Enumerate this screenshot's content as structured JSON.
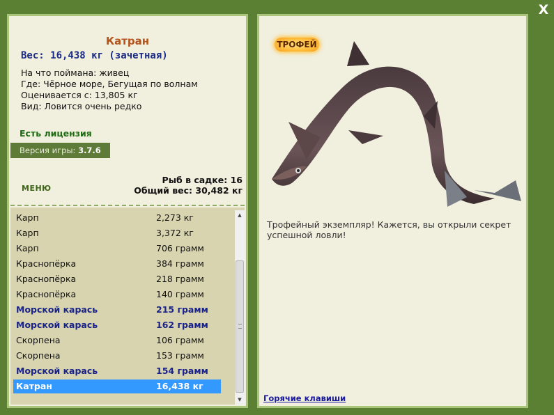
{
  "close_label": "X",
  "fish": {
    "name": "Катран",
    "weight": "Вес: 16,438 кг (зачетная)",
    "bait": "На что поймана: живец",
    "place": "Где: Чёрное море, Бегущая по волнам",
    "valued": "Оценивается с: 13,805 кг",
    "kind": "Вид: Ловится очень редко"
  },
  "license": "Есть лицензия",
  "version": {
    "label": "Версия игры:",
    "value": "3.7.6"
  },
  "menu_label": "МЕНЮ",
  "stats": {
    "fish_count": "Рыб в садке: 16",
    "total_weight": "Общий вес: 30,482 кг"
  },
  "catch_list": [
    {
      "name": "Карп",
      "weight": "2,273 кг",
      "highlight": false
    },
    {
      "name": "Карп",
      "weight": "3,372 кг",
      "highlight": false
    },
    {
      "name": "Карп",
      "weight": "706 грамм",
      "highlight": false
    },
    {
      "name": "Краснопёрка",
      "weight": "384 грамм",
      "highlight": false
    },
    {
      "name": "Краснопёрка",
      "weight": "218 грамм",
      "highlight": false
    },
    {
      "name": "Краснопёрка",
      "weight": "140 грамм",
      "highlight": false
    },
    {
      "name": "Морской карась",
      "weight": "215 грамм",
      "highlight": true
    },
    {
      "name": "Морской карась",
      "weight": "162 грамм",
      "highlight": true
    },
    {
      "name": "Скорпена",
      "weight": "106 грамм",
      "highlight": false
    },
    {
      "name": "Скорпена",
      "weight": "153 грамм",
      "highlight": false
    },
    {
      "name": "Морской карась",
      "weight": "154 грамм",
      "highlight": true
    },
    {
      "name": "Катран",
      "weight": "16,438 кг",
      "highlight": false,
      "selected": true
    }
  ],
  "trophy": {
    "badge": "ТРОФЕЙ",
    "text": "Трофейный экземпляр! Кажется, вы открыли секрет успешной ловли!"
  },
  "hotkeys_label": "Горячие клавиши",
  "colors": {
    "background": "#5b7f33",
    "panel": "#f1efde",
    "panel_border": "#a9c57a",
    "fish_name": "#b5541c",
    "weight_text": "#1a2a87",
    "license": "#1f6b14",
    "list_bg": "#d8d4b0",
    "selected_row": "#3399ff",
    "highlight_row": "#1a2388"
  },
  "icons": [
    "close-icon",
    "scroll-up-icon",
    "scroll-down-icon",
    "shark-image"
  ]
}
